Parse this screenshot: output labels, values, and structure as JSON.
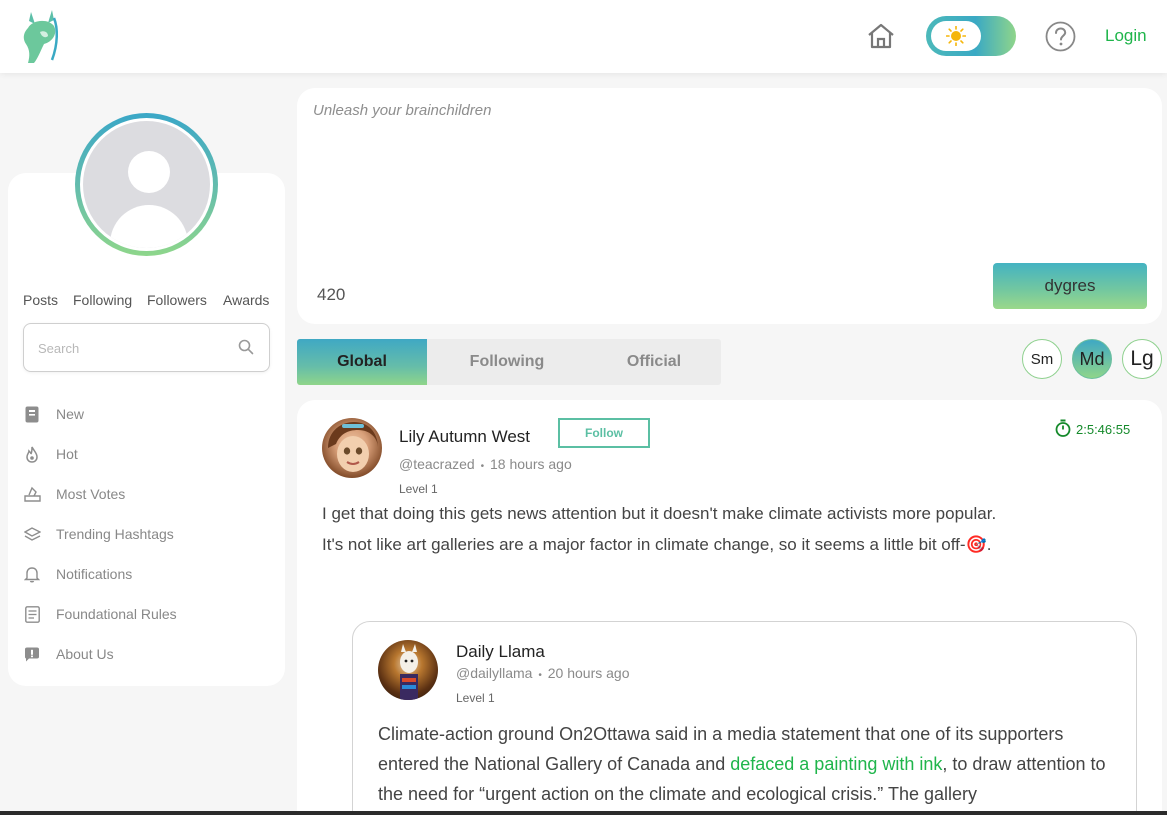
{
  "header": {
    "logo_icon": "llama-logo-icon",
    "home_icon": "home-icon",
    "theme_icon": "sun-icon",
    "help_icon": "help-icon",
    "login_label": "Login"
  },
  "profile": {
    "avatar_icon": "user-avatar-icon",
    "stats": {
      "posts": "Posts",
      "following": "Following",
      "followers": "Followers",
      "awards": "Awards"
    }
  },
  "search": {
    "placeholder": "Search"
  },
  "nav": {
    "items": [
      {
        "label": "New",
        "icon": "new-icon"
      },
      {
        "label": "Hot",
        "icon": "flame-icon"
      },
      {
        "label": "Most Votes",
        "icon": "vote-icon"
      },
      {
        "label": "Trending Hashtags",
        "icon": "hashtag-icon"
      },
      {
        "label": "Notifications",
        "icon": "bell-icon"
      },
      {
        "label": "Foundational Rules",
        "icon": "rules-icon"
      },
      {
        "label": "About Us",
        "icon": "info-icon"
      }
    ]
  },
  "composer": {
    "placeholder": "Unleash your brainchildren",
    "char_count": "420",
    "submit_label": "dygres"
  },
  "feed_tabs": {
    "global": "Global",
    "following": "Following",
    "official": "Official"
  },
  "text_sizes": {
    "sm": "Sm",
    "md": "Md",
    "lg": "Lg",
    "selected": "Md"
  },
  "post": {
    "author": "Lily Autumn West",
    "follow_label": "Follow",
    "handle": "@teacrazed",
    "separator": "•",
    "time_ago": "18 hours ago",
    "level": "Level 1",
    "timer": "2:5:46:55",
    "text_line1": "I get that doing this gets news attention but it doesn't make climate activists more popular.",
    "text_line2": "It's not like art galleries are a major factor in climate change, so it seems a little bit off-",
    "text_emoji": "🎯",
    "text_end": "."
  },
  "quote": {
    "author": "Daily Llama",
    "handle": "@dailyllama",
    "separator": "•",
    "time_ago": "20 hours ago",
    "level": "Level 1",
    "text_before": "Climate-action ground On2Ottawa said in a media statement that one of its supporters entered the National Gallery of Canada and ",
    "link_text": "defaced a painting with ink",
    "text_after": ", to draw attention to the need for “urgent action on the climate and ecological crisis.” The gallery"
  }
}
